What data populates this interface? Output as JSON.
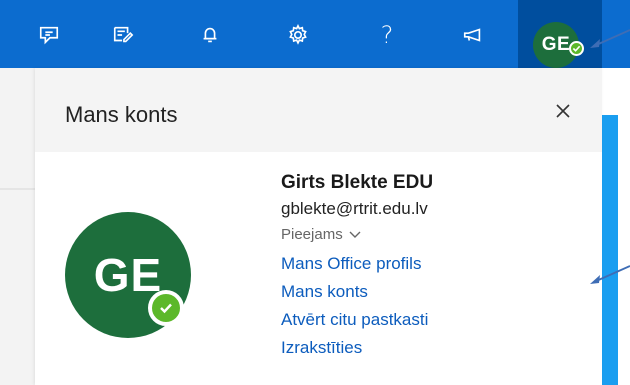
{
  "header": {
    "avatar_initials": "GE",
    "help_label": "?"
  },
  "panel": {
    "title": "Mans konts",
    "avatar_initials": "GE",
    "user_name": "Girts Blekte EDU",
    "email": "gblekte@rtrit.edu.lv",
    "presence": "Pieejams",
    "links": [
      "Mans Office profils",
      "Mans konts",
      "Atvērt citu pastkasti",
      "Izrakstīties"
    ]
  },
  "colors": {
    "topbar": "#0c6ccf",
    "avatar_tile": "#004e9e",
    "avatar_green": "#1d6e3c",
    "status_green": "#5cb82a",
    "link_blue": "#0c5cbd",
    "side_blue": "#1a9ef0"
  },
  "icons": [
    "chat-icon",
    "tasks-icon",
    "bell-icon",
    "gear-icon",
    "help-icon",
    "megaphone-icon",
    "checkmark-icon",
    "close-icon",
    "chevron-down-icon",
    "annotation-arrow-icon"
  ]
}
